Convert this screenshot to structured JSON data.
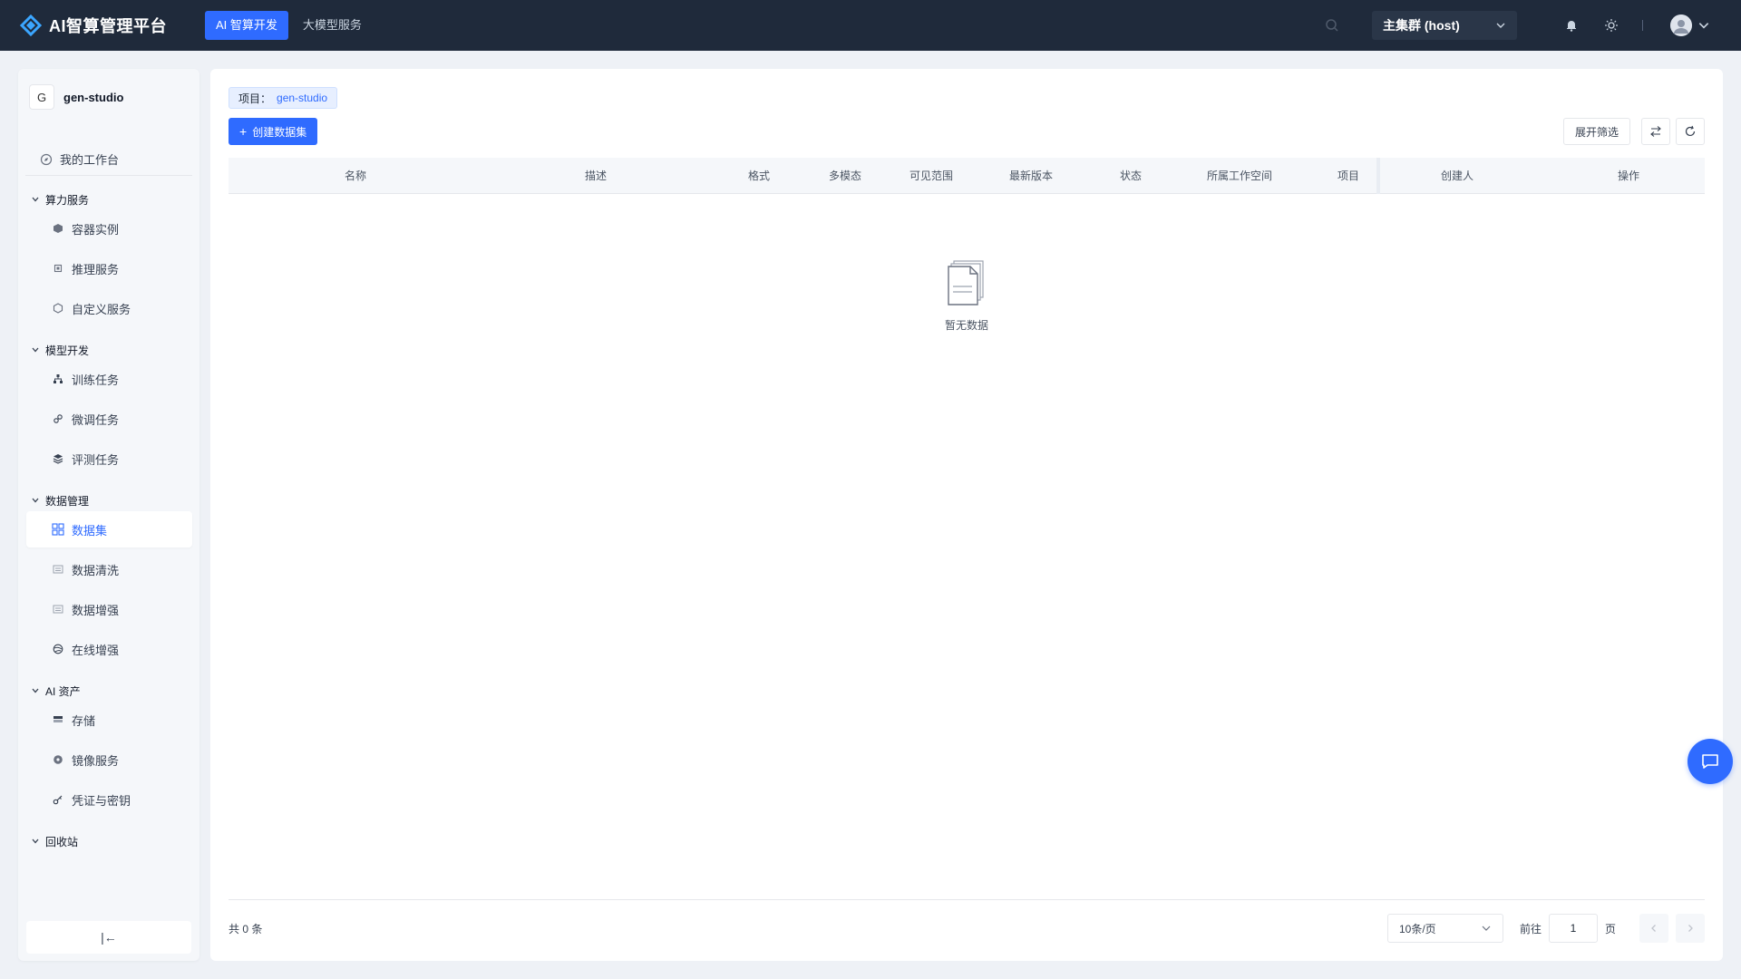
{
  "app": {
    "title": "AI智算管理平台",
    "nav": [
      {
        "label": "AI 智算开发",
        "active": true
      },
      {
        "label": "大模型服务",
        "active": false
      }
    ],
    "cluster_select": "主集群 (host)",
    "accent": "#2f6bff",
    "topbar_color": "#1f2a3b"
  },
  "sidebar": {
    "project_avatar": "G",
    "project_name": "gen-studio",
    "workbench": "我的工作台",
    "groups": [
      {
        "title": "算力服务",
        "items": [
          {
            "label": "容器实例",
            "icon": "cube-icon"
          },
          {
            "label": "推理服务",
            "icon": "cpu-icon"
          },
          {
            "label": "自定义服务",
            "icon": "hexagon-icon"
          }
        ]
      },
      {
        "title": "模型开发",
        "items": [
          {
            "label": "训练任务",
            "icon": "hierarchy-icon"
          },
          {
            "label": "微调任务",
            "icon": "link-icon"
          },
          {
            "label": "评测任务",
            "icon": "layers-icon"
          }
        ]
      },
      {
        "title": "数据管理",
        "items": [
          {
            "label": "数据集",
            "icon": "grid-icon",
            "active": true
          },
          {
            "label": "数据清洗",
            "icon": "list-icon"
          },
          {
            "label": "数据增强",
            "icon": "list-icon"
          },
          {
            "label": "在线增强",
            "icon": "globe-icon"
          }
        ]
      },
      {
        "title": "AI 资产",
        "items": [
          {
            "label": "存储",
            "icon": "storage-icon"
          },
          {
            "label": "镜像服务",
            "icon": "disk-icon"
          },
          {
            "label": "凭证与密钥",
            "icon": "key-icon"
          }
        ]
      },
      {
        "title": "回收站",
        "items": []
      }
    ],
    "collapse": "|←"
  },
  "main": {
    "project_tag_label": "项目：",
    "project_tag_value": "gen-studio",
    "create_button": "创建数据集",
    "filter_button": "展开筛选",
    "columns": [
      "名称",
      "描述",
      "格式",
      "多模态",
      "可见范围",
      "最新版本",
      "状态",
      "所属工作空间",
      "项目",
      "创建人",
      "操作"
    ],
    "empty_text": "暂无数据",
    "total": "共 0 条",
    "page_size": "10条/页",
    "goto_label": "前往",
    "goto_value": "1",
    "page_unit": "页"
  }
}
